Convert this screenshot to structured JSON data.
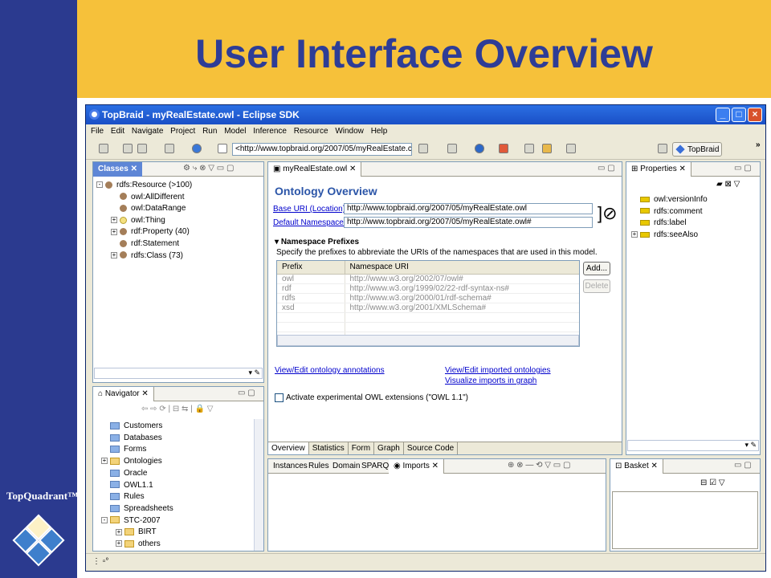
{
  "slide": {
    "title": "User Interface Overview",
    "brand": "TopQuadrant™",
    "colors": {
      "left_bar": "#2B3A8F",
      "top_bar": "#F6C13A",
      "title": "#2E3D96"
    }
  },
  "window": {
    "title": "TopBraid - myRealEstate.owl - Eclipse SDK",
    "controls": {
      "minimize": "_",
      "maximize": "□",
      "close": "×"
    }
  },
  "menu": [
    "File",
    "Edit",
    "Navigate",
    "Project",
    "Run",
    "Model",
    "Inference",
    "Resource",
    "Window",
    "Help"
  ],
  "toolbar": {
    "url": "<http://www.topbraid.org/2007/05/myRealEstate.c",
    "perspective": "TopBraid",
    "more": "»"
  },
  "classes_view": {
    "tab": "Classes",
    "items": [
      {
        "label": "rdfs:Resource  (>100)",
        "indent": 0,
        "expander": "-",
        "icon": "ball"
      },
      {
        "label": "owl:AllDifferent",
        "indent": 1,
        "expander": "",
        "icon": "ball"
      },
      {
        "label": "owl:DataRange",
        "indent": 1,
        "expander": "",
        "icon": "ball"
      },
      {
        "label": "owl:Thing",
        "indent": 1,
        "expander": "+",
        "icon": "hollow"
      },
      {
        "label": "rdf:Property  (40)",
        "indent": 1,
        "expander": "+",
        "icon": "ball"
      },
      {
        "label": "rdf:Statement",
        "indent": 1,
        "expander": "",
        "icon": "ball"
      },
      {
        "label": "rdfs:Class  (73)",
        "indent": 1,
        "expander": "+",
        "icon": "ball"
      }
    ]
  },
  "navigator": {
    "tab": "Navigator",
    "items": [
      {
        "label": "Customers",
        "indent": 0,
        "expander": "",
        "open": false
      },
      {
        "label": "Databases",
        "indent": 0,
        "expander": "",
        "open": false
      },
      {
        "label": "Forms",
        "indent": 0,
        "expander": "",
        "open": false
      },
      {
        "label": "Ontologies",
        "indent": 0,
        "expander": "+",
        "open": true
      },
      {
        "label": "Oracle",
        "indent": 0,
        "expander": "",
        "open": false
      },
      {
        "label": "OWL1.1",
        "indent": 0,
        "expander": "",
        "open": false
      },
      {
        "label": "Rules",
        "indent": 0,
        "expander": "",
        "open": false
      },
      {
        "label": "Spreadsheets",
        "indent": 0,
        "expander": "",
        "open": false
      },
      {
        "label": "STC-2007",
        "indent": 0,
        "expander": "-",
        "open": true
      },
      {
        "label": "BIRT",
        "indent": 1,
        "expander": "+",
        "open": true
      },
      {
        "label": "others",
        "indent": 1,
        "expander": "+",
        "open": true
      }
    ]
  },
  "editor": {
    "tab": "myRealEstate.owl",
    "heading": "Ontology Overview",
    "base_uri_label": "Base URI (Location):",
    "base_uri": "http://www.topbraid.org/2007/05/myRealEstate.owl",
    "default_ns_label": "Default Namespace:",
    "default_ns": "http://www.topbraid.org/2007/05/myRealEstate.owl#",
    "ns_section": "Namespace Prefixes",
    "ns_desc": "Specify the prefixes to abbreviate the URIs of the namespaces that are used in this model.",
    "ns_columns": [
      "Prefix",
      "Namespace URI"
    ],
    "ns_rows": [
      [
        "owl",
        "http://www.w3.org/2002/07/owl#"
      ],
      [
        "rdf",
        "http://www.w3.org/1999/02/22-rdf-syntax-ns#"
      ],
      [
        "rdfs",
        "http://www.w3.org/2000/01/rdf-schema#"
      ],
      [
        "xsd",
        "http://www.w3.org/2001/XMLSchema#"
      ]
    ],
    "add_label": "Add...",
    "delete_label": "Delete",
    "link_annotations": "View/Edit ontology annotations",
    "link_imports": "View/Edit imported ontologies",
    "link_visualize": "Visualize imports in graph",
    "checkbox_label": "Activate experimental OWL extensions (\"OWL 1.1\")",
    "tabs": [
      "Overview",
      "Statistics",
      "Form",
      "Graph",
      "Source Code"
    ]
  },
  "properties_view": {
    "tab": "Properties",
    "items": [
      {
        "label": "owl:versionInfo",
        "expander": ""
      },
      {
        "label": "rdfs:comment",
        "expander": ""
      },
      {
        "label": "rdfs:label",
        "expander": ""
      },
      {
        "label": "rdfs:seeAlso",
        "expander": "+"
      }
    ]
  },
  "bottom_view": {
    "tabs": [
      "Instances",
      "Rules",
      "Domain",
      "SPARQL",
      "Imports"
    ]
  },
  "basket_view": {
    "tab": "Basket"
  }
}
